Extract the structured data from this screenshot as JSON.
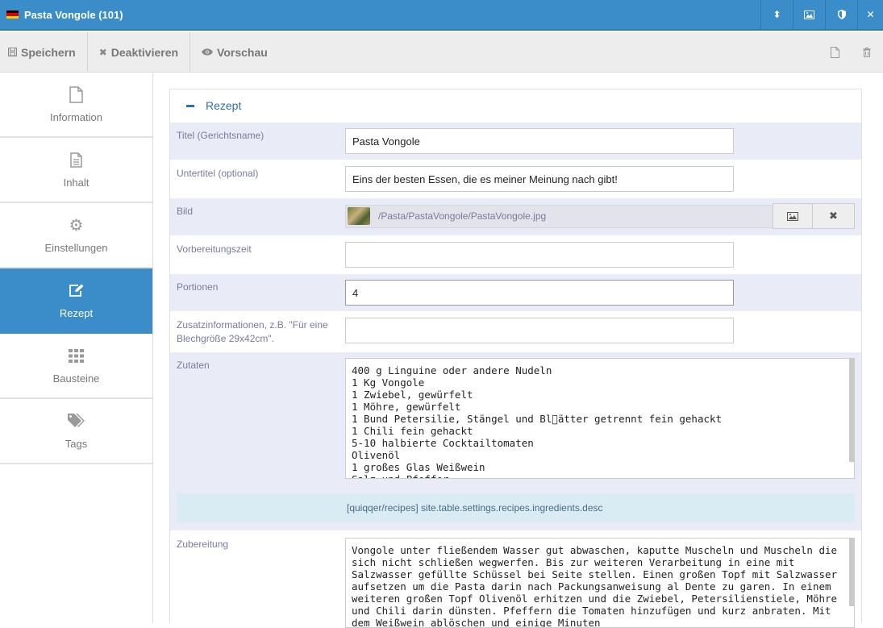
{
  "window": {
    "title": "Pasta Vongole (101)",
    "flag_colors": [
      "#000000",
      "#dd0000",
      "#ffce00"
    ]
  },
  "titlebar_buttons": [
    {
      "name": "sort-icon",
      "glyph": "⬍"
    },
    {
      "name": "image-icon",
      "glyph": "▣"
    },
    {
      "name": "shield-icon",
      "glyph": "⛉"
    },
    {
      "name": "close-icon",
      "glyph": "✕"
    }
  ],
  "toolbar": {
    "save_label": "Speichern",
    "deactivate_label": "Deaktivieren",
    "preview_label": "Vorschau"
  },
  "sidebar": {
    "items": [
      {
        "label": "Information",
        "icon": "file-icon"
      },
      {
        "label": "Inhalt",
        "icon": "file-text-icon"
      },
      {
        "label": "Einstellungen",
        "icon": "gear-icon"
      },
      {
        "label": "Rezept",
        "icon": "edit-icon"
      },
      {
        "label": "Bausteine",
        "icon": "grid-icon"
      },
      {
        "label": "Tags",
        "icon": "tags-icon"
      }
    ],
    "active": "Rezept"
  },
  "section": {
    "title": "Rezept"
  },
  "fields": {
    "title_label": "Titel (Gerichtsname)",
    "title_value": "Pasta Vongole",
    "subtitle_label": "Untertitel (optional)",
    "subtitle_value": "Eins der besten Essen, die es meiner Meinung nach gibt!",
    "image_label": "Bild",
    "image_path": "/Pasta/PastaVongole/PastaVongole.jpg",
    "prep_label": "Vorbereitungszeit",
    "prep_value": "",
    "portions_label": "Portionen",
    "portions_value": "4",
    "extra_label": "Zusatzinformationen, z.B. \"Für eine Blechgröße 29x42cm\".",
    "extra_value": "",
    "ingredients_label": "Zutaten",
    "ingredients_value": "400 g Linguine oder andere Nudeln\n1 Kg Vongole\n1 Zwiebel, gewürfelt\n1 Möhre, gewürfelt\n1 Bund Petersilie, Stängel und Bl\u0000ätter getrennt fein gehackt\n1 Chili fein gehackt\n5-10 halbierte Cocktailtomaten\nOlivenöl\n1 großes Glas Weißwein\nSalz und Pfeffer",
    "ingredients_desc": "[quiqqer/recipes] site.table.settings.recipes.ingredients.desc",
    "preparation_label": "Zubereitung",
    "preparation_value": "Vongole unter fließendem Wasser gut abwaschen, kaputte Muscheln und Muscheln die sich nicht schließen wegwerfen. Bis zur weiteren Verarbeitung in eine mit Salzwasser gefüllte Schüssel bei Seite stellen. Einen großen Topf mit Salzwasser aufsetzen um die Pasta darin nach Packungsanweisung al Dente zu garen. In einem weiteren großen Topf Olivenöl erhitzen und die Zwiebel, Petersilienstiele, Möhre und Chili darin dünsten. Pfeffern die Tomaten hinzufügen und kurz anbraten. Mit dem Weißwein ablöschen und einige Minuten"
  }
}
